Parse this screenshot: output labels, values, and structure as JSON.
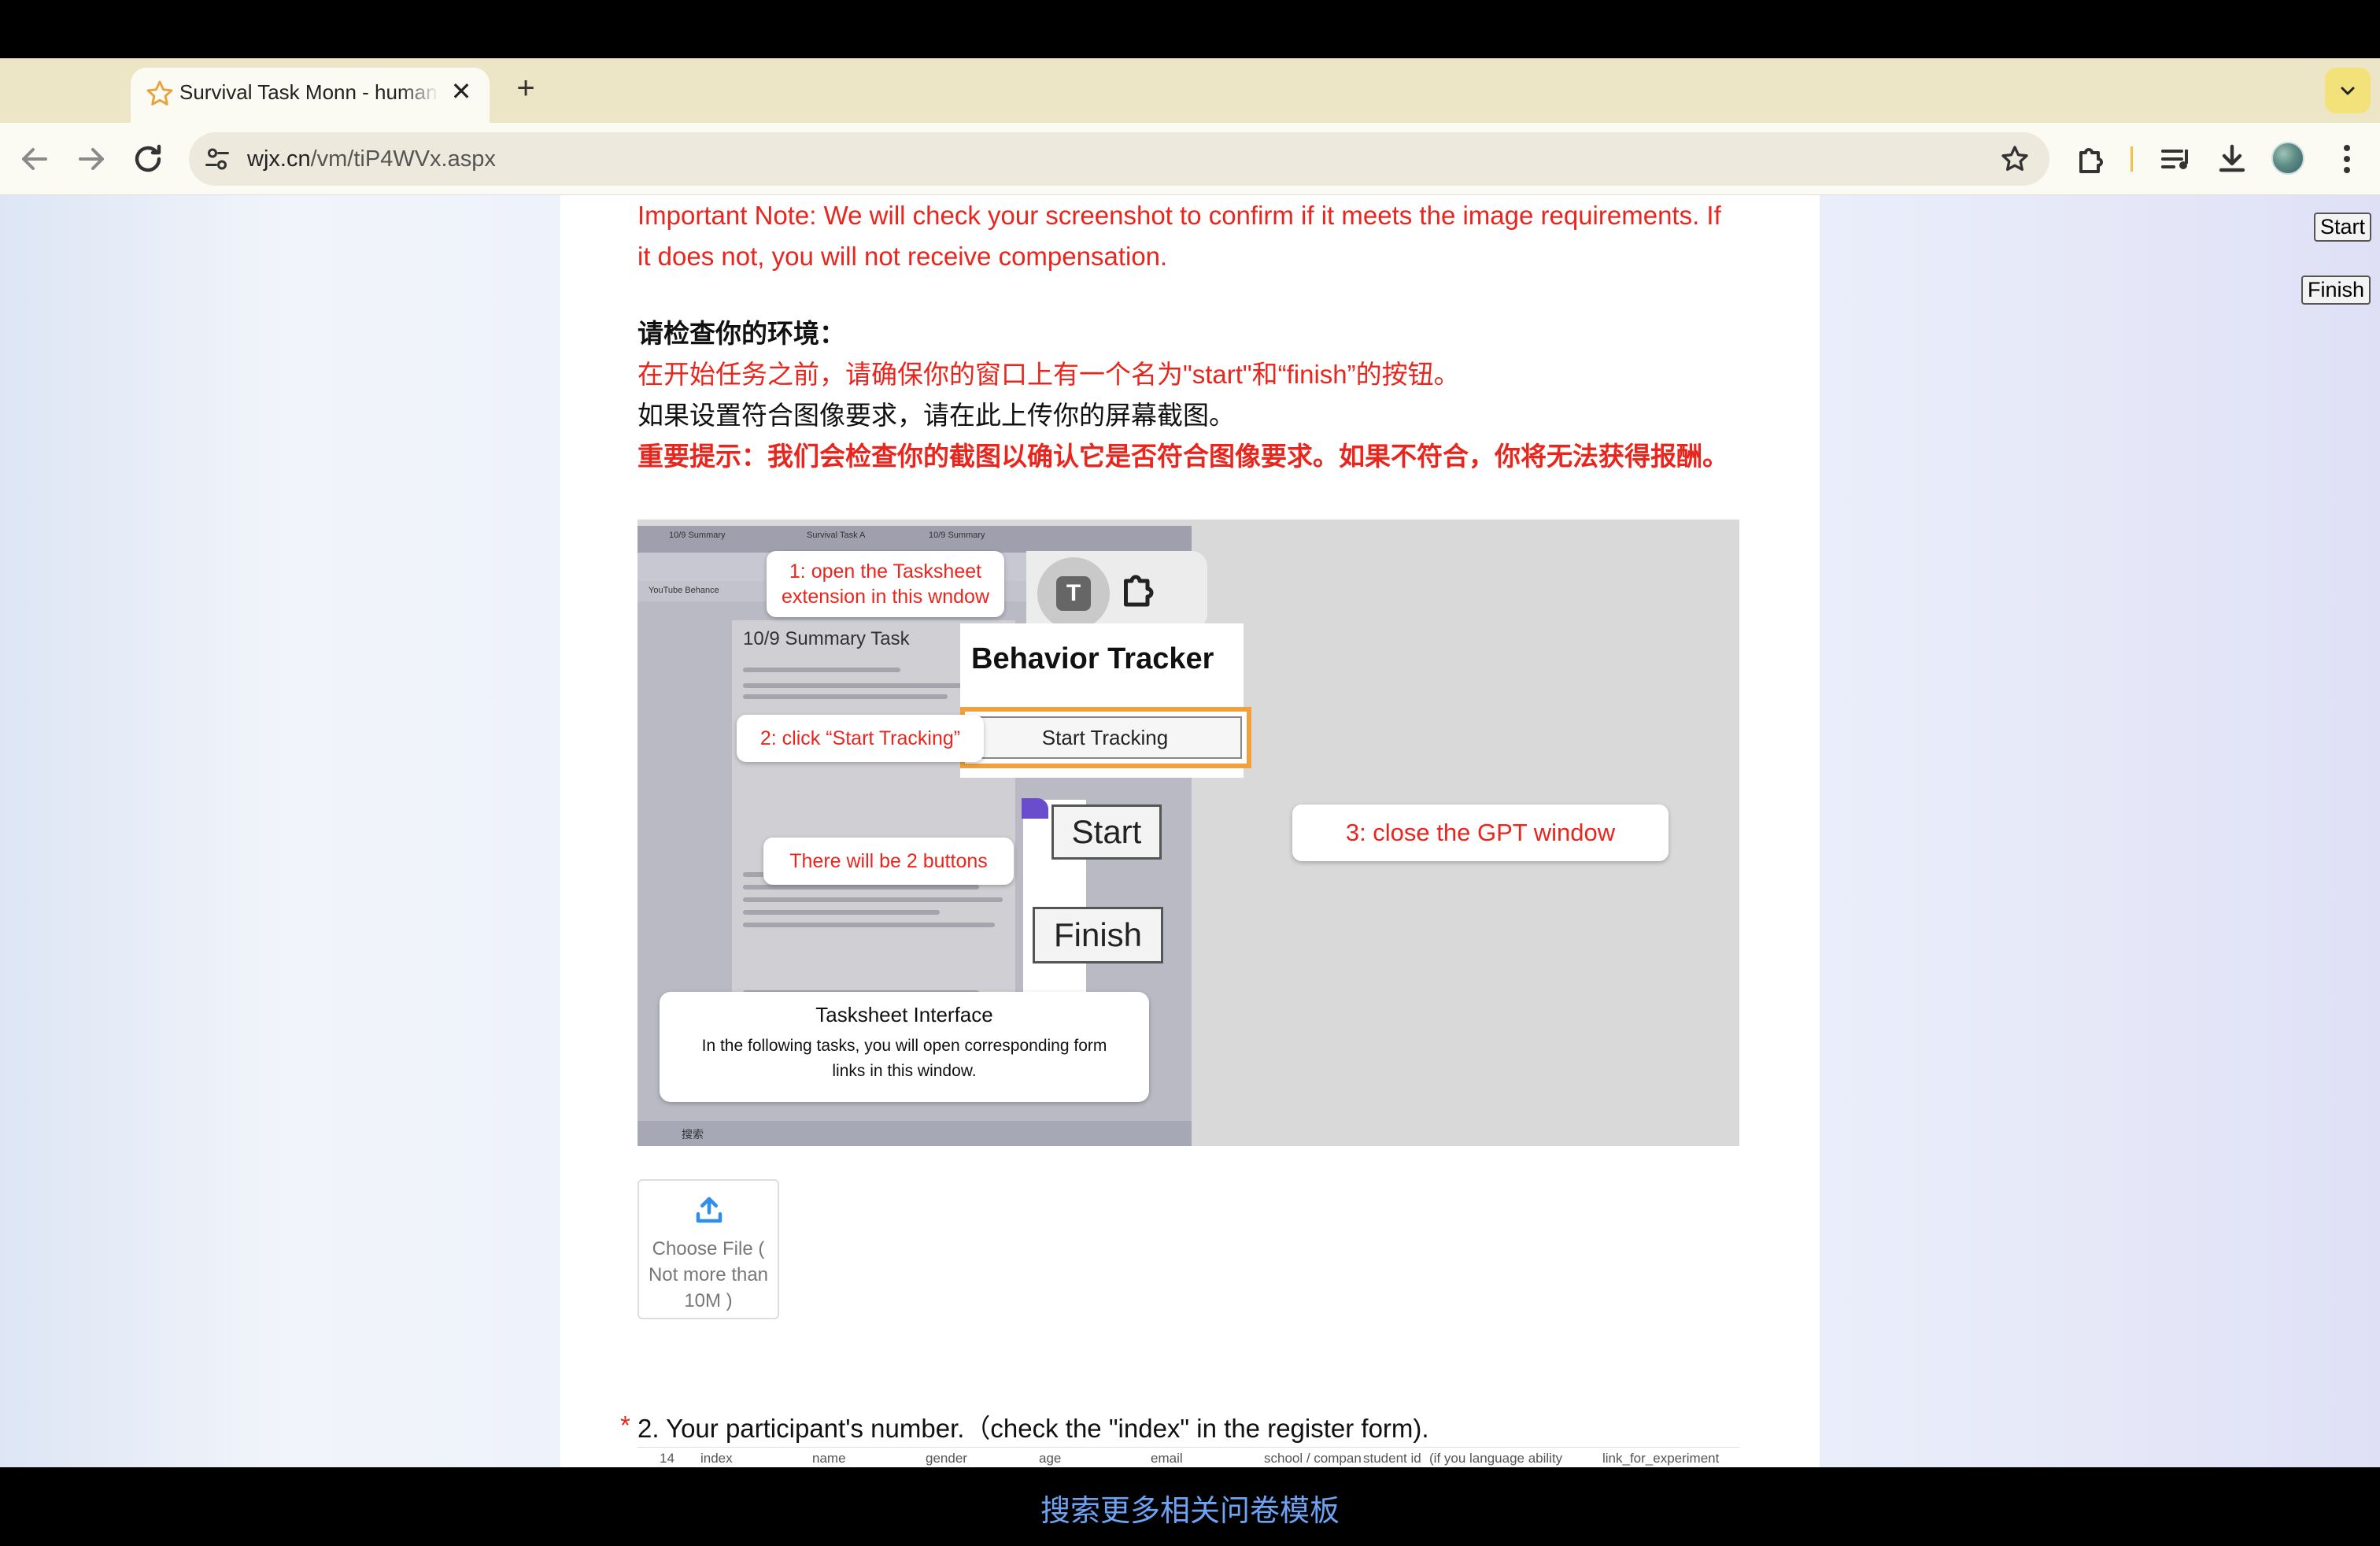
{
  "browser": {
    "tab_title": "Survival Task Monn - human a",
    "url_host": "wjx.cn",
    "url_path": "/vm/tiP4WVx.aspx"
  },
  "floating_buttons": {
    "start": "Start",
    "finish": "Finish"
  },
  "content": {
    "note_en": "Important Note: We will check your screenshot to confirm if it meets the image requirements. If it does not, you will not receive compensation.",
    "env_heading": "请检查你的环境：",
    "env_line1": "在开始任务之前，请确保你的窗口上有一个名为\"start\"和“finish”的按钮。",
    "env_line2": "如果设置符合图像要求，请在此上传你的屏幕截图。",
    "env_note_cn": "重要提示：我们会检查你的截图以确认它是否符合图像要求。如果不符合，你将无法获得报酬。"
  },
  "instruction_image": {
    "step1": "1: open the Tasksheet extension in this wndow",
    "extension_letter": "T",
    "panel_title": "Behavior Tracker",
    "start_tracking": "Start Tracking",
    "step2": "2: click “Start Tracking”",
    "step3": "3: close the GPT window",
    "two_buttons": "There will be 2 buttons",
    "start_btn": "Start",
    "finish_btn": "Finish",
    "sheet_title": "Tasksheet Interface",
    "sheet_desc": "In the following tasks, you will open corresponding form links in this window.",
    "doc_title": "10/9 Summary Task",
    "screenshot_tabs": [
      "10/9 Summary",
      "Survival Task A",
      "10/9 Summary"
    ],
    "screenshot_bookmarks": "YouTube   Behance",
    "screenshot_search": "搜索"
  },
  "upload": {
    "label": "Choose File ( Not more than 10M )"
  },
  "question2": {
    "required_mark": "*",
    "text": "2. Your participant's number.（check the \"index\" in the register form).",
    "table_headers": [
      "14",
      "index",
      "name",
      "gender",
      "age",
      "email",
      "school / compan",
      "student id",
      "(if you language ability",
      "link_for_experiment"
    ]
  },
  "footer": {
    "text": "搜索更多相关问卷模板"
  }
}
